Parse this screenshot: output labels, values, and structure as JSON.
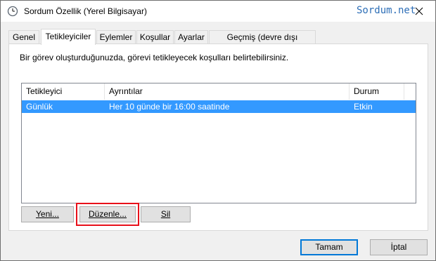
{
  "window": {
    "title": "Sordum Özellik (Yerel Bilgisayar)",
    "watermark": "Sordum.net",
    "accent": "#0078d7",
    "highlight_color": "#e8101a"
  },
  "tabs": [
    {
      "label": "Genel"
    },
    {
      "label": "Tetikleyiciler",
      "active": true
    },
    {
      "label": "Eylemler"
    },
    {
      "label": "Koşullar"
    },
    {
      "label": "Ayarlar"
    },
    {
      "label": "Geçmiş (devre dışı bırakıldı)"
    }
  ],
  "panel": {
    "description": "Bir görev oluşturduğunuzda, görevi tetikleyecek koşulları belirtebilirsiniz."
  },
  "triggers_table": {
    "columns": [
      "Tetikleyici",
      "Ayrıntılar",
      "Durum"
    ],
    "rows": [
      {
        "trigger": "Günlük",
        "details": "Her 10 günde bir 16:00 saatinde",
        "status": "Etkin",
        "selected": true
      }
    ]
  },
  "panel_buttons": {
    "new_label": "Yeni...",
    "edit_label": "Düzenle...",
    "delete_label": "Sil"
  },
  "dialog_buttons": {
    "ok_label": "Tamam",
    "cancel_label": "İptal"
  }
}
